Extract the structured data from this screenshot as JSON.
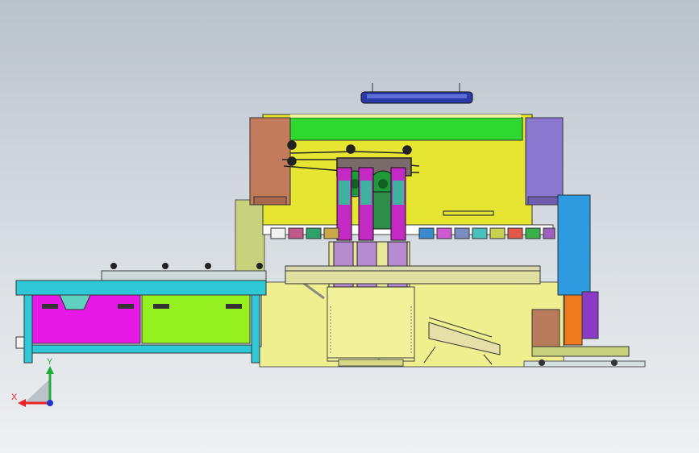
{
  "triad": {
    "x_label": "X",
    "y_label": "Y",
    "x_color": "#e8212b",
    "y_color": "#1fae3a",
    "z_color": "#2233cc"
  },
  "colors": {
    "background_top": "#b9c3cc",
    "background_bottom": "#eef0f2",
    "press_body": "#e6e632",
    "press_top_band": "#2fd82f",
    "left_column": "#c27c5c",
    "right_column": "#8a78d0",
    "base_yellow": "#efef8f",
    "table_top": "#2ec8d8",
    "drawer_magenta": "#e619e6",
    "drawer_green": "#94f01f",
    "hydraulic_purple": "#c429c4",
    "blue_guard": "#2e9ae0",
    "orange_panel": "#f07a1e",
    "top_lamp": "#2a3aa8"
  }
}
